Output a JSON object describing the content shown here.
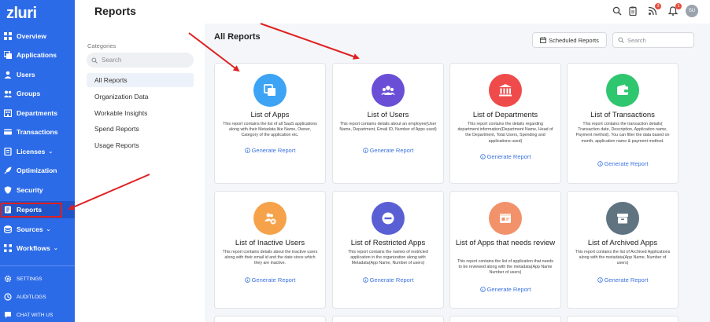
{
  "app": {
    "logo": "zluri"
  },
  "sidebar": {
    "items": [
      {
        "label": "Overview",
        "icon": "grid-icon"
      },
      {
        "label": "Applications",
        "icon": "apps-icon"
      },
      {
        "label": "Users",
        "icon": "user-icon"
      },
      {
        "label": "Groups",
        "icon": "groups-icon"
      },
      {
        "label": "Departments",
        "icon": "departments-icon"
      },
      {
        "label": "Transactions",
        "icon": "card-icon"
      },
      {
        "label": "Licenses",
        "icon": "license-icon",
        "caret": "⌄"
      },
      {
        "label": "Optimization",
        "icon": "rocket-icon"
      },
      {
        "label": "Security",
        "icon": "shield-icon"
      },
      {
        "label": "Reports",
        "icon": "report-icon",
        "active": true
      },
      {
        "label": "Sources",
        "icon": "sources-icon",
        "caret": "⌄"
      },
      {
        "label": "Workflows",
        "icon": "workflow-icon",
        "caret": "⌄"
      }
    ],
    "bottom": [
      {
        "label": "SETTINGS",
        "icon": "gear-icon"
      },
      {
        "label": "AUDITLOGS",
        "icon": "audit-icon"
      },
      {
        "label": "CHAT WITH US",
        "icon": "chat-icon"
      }
    ]
  },
  "header": {
    "title": "Reports",
    "notifications_badge": "1",
    "updates_badge": "3",
    "avatar_initials": "SU"
  },
  "categories": {
    "heading": "Categories",
    "search_placeholder": "Search",
    "items": [
      "All Reports",
      "Organization Data",
      "Workable Insights",
      "Spend Reports",
      "Usage Reports"
    ],
    "active": "All Reports"
  },
  "main": {
    "title": "All Reports",
    "scheduled_button": "Scheduled Reports",
    "search_placeholder": "Search",
    "generate_label": "Generate Report",
    "cards": [
      {
        "title": "List of Apps",
        "desc": "This report contains the list of all SaaS applications along with their Metadata like Name, Owner, Category of the application etc.",
        "color": "#3da3f5",
        "icon": "apps-icon"
      },
      {
        "title": "List of Users",
        "desc": "This report contains details about an employee(User Name, Department, Email ID, Number of Apps used)",
        "color": "#6a4fd6",
        "icon": "users-icon"
      },
      {
        "title": "List of Departments",
        "desc": "This report contains the details regarding department information(Department Name, Head of the Department, Total Users, Spending and applications used)",
        "color": "#ef4b4b",
        "icon": "bank-icon"
      },
      {
        "title": "List of Transactions",
        "desc": "This report contains the transaction details( Transaction date, Description, Application name, Payment method). You can filter the data based on month, application name & payment method.",
        "color": "#2ec66f",
        "icon": "wallet-icon"
      },
      {
        "title": "List of Inactive Users",
        "desc": "This report contains details about the inactive users along with their email id and the date since which they are inactive.",
        "color": "#f6a24a",
        "icon": "inactive-users-icon"
      },
      {
        "title": "List of Restricted Apps",
        "desc": "This report contains the names of restricted application in the organization along with Metadata(App Name, Number of users)",
        "color": "#5b5fd4",
        "icon": "restricted-icon"
      },
      {
        "title": "List of Apps that needs review",
        "desc": "This report contains the list of application that needs to be reviewed along with the metadata(App Name Number of users)",
        "color": "#f2926a",
        "icon": "review-icon"
      },
      {
        "title": "List of Archived Apps",
        "desc": "This report contains the list of Archived Applications along with the metadata(App Name, Number of users)",
        "color": "#5f7381",
        "icon": "archive-icon"
      }
    ]
  },
  "annotation_color": "#e02020"
}
